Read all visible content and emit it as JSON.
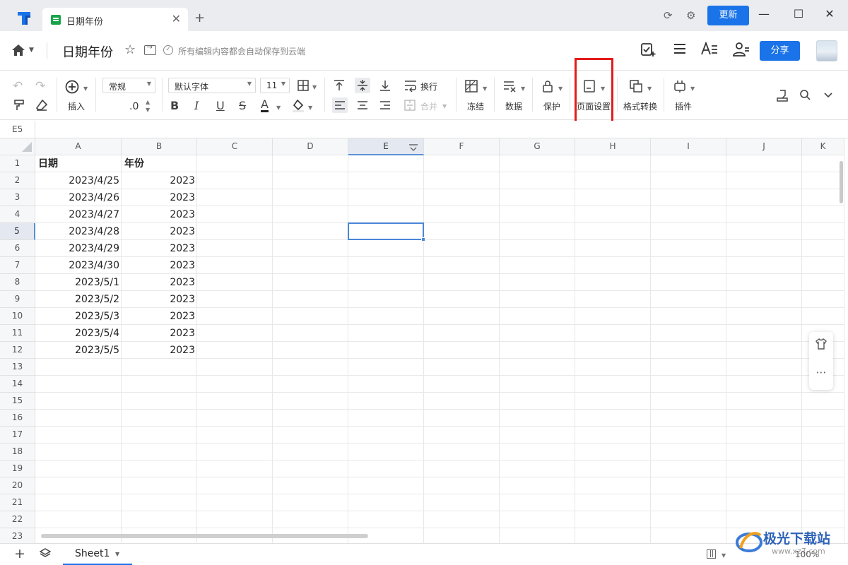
{
  "titlebar": {
    "tab_label": "日期年份",
    "tab_close": "✕",
    "new_tab": "+",
    "update_label": "更新",
    "icons": [
      "sync-icon",
      "settings-icon"
    ],
    "window_controls": {
      "minimize": "—",
      "maximize": "☐",
      "close": "✕"
    }
  },
  "docbar": {
    "title": "日期年份",
    "star": "☆",
    "save_status_icon": "✓",
    "save_status": "所有编辑内容都会自动保存到云端",
    "share_label": "分享",
    "icons": [
      "review-add-icon",
      "menu-icon",
      "text-format-icon",
      "collaborators-icon"
    ]
  },
  "toolbar": {
    "insert_label": "插入",
    "number_format": "常规",
    "decimal": ".0",
    "font_name": "默认字体",
    "font_size": "11",
    "bold": "B",
    "italic": "I",
    "underline": "U",
    "strike": "S",
    "font_color": "A",
    "wrap_label": "换行",
    "merge_label": "合并",
    "freeze_label": "冻结",
    "data_label": "数据",
    "protect_label": "保护",
    "page_setup_label": "页面设置",
    "format_convert_label": "格式转换",
    "plugin_label": "插件"
  },
  "formula_bar": {
    "cell_ref": "E5"
  },
  "grid": {
    "columns": [
      "A",
      "B",
      "C",
      "D",
      "E",
      "F",
      "G",
      "H",
      "I",
      "J",
      "K"
    ],
    "active_column": "E",
    "active_row": 5,
    "row_numbers": [
      "1",
      "2",
      "3",
      "4",
      "5",
      "6",
      "7",
      "8",
      "9",
      "10",
      "11",
      "12",
      "13",
      "14",
      "15",
      "16",
      "17",
      "18",
      "19",
      "20",
      "21",
      "22",
      "23"
    ],
    "header_row": [
      "日期",
      "年份"
    ],
    "rows": [
      [
        "2023/4/25",
        "2023"
      ],
      [
        "2023/4/26",
        "2023"
      ],
      [
        "2023/4/27",
        "2023"
      ],
      [
        "2023/4/28",
        "2023"
      ],
      [
        "2023/4/29",
        "2023"
      ],
      [
        "2023/4/30",
        "2023"
      ],
      [
        "2023/5/1",
        "2023"
      ],
      [
        "2023/5/2",
        "2023"
      ],
      [
        "2023/5/3",
        "2023"
      ],
      [
        "2023/5/4",
        "2023"
      ],
      [
        "2023/5/5",
        "2023"
      ]
    ]
  },
  "float_panel": {
    "more": "⋯"
  },
  "sheetbar": {
    "add": "+",
    "sheet_name": "Sheet1",
    "zoom": "100%"
  },
  "watermark": {
    "text": "极光下载站",
    "url": "www.xz7.com"
  }
}
